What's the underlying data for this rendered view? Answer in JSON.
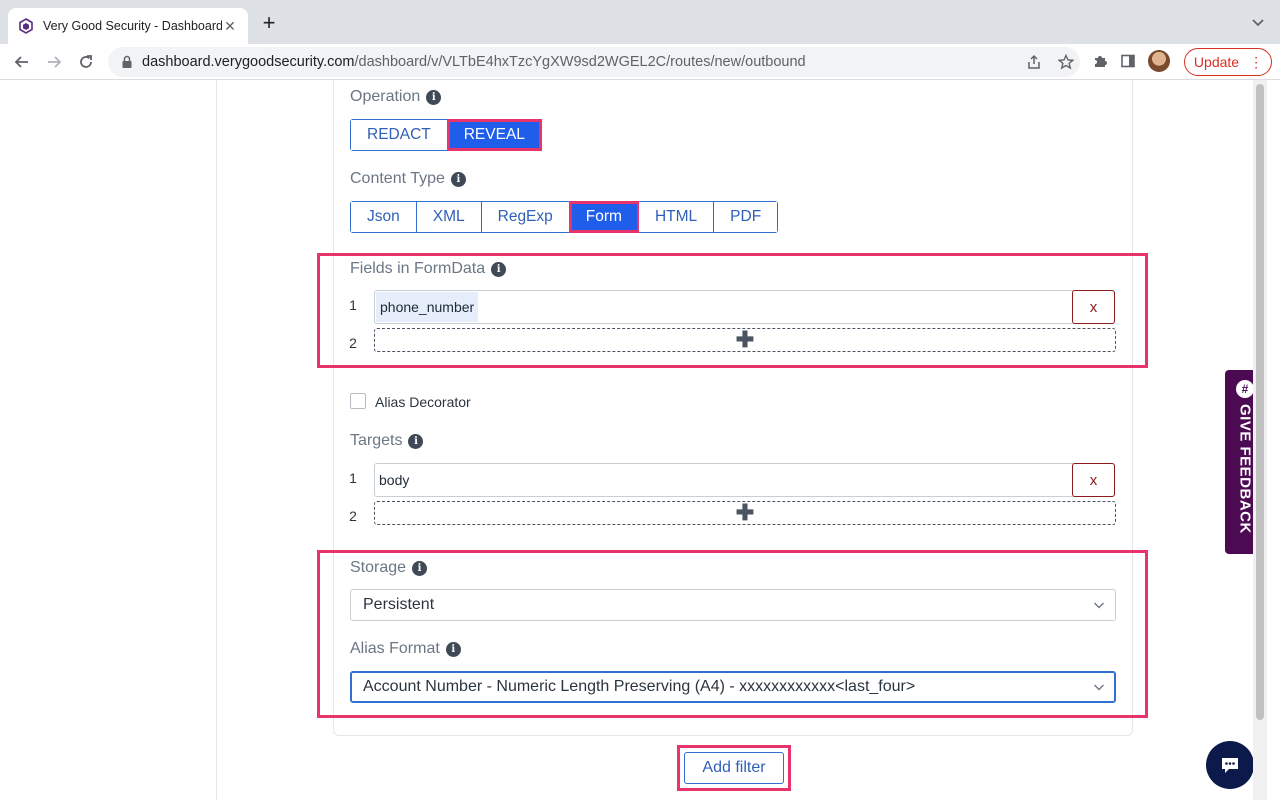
{
  "browser": {
    "tab_title": "Very Good Security - Dashboard",
    "tab_close": "✕",
    "new_tab": "+",
    "url_host": "dashboard.verygoodsecurity.com",
    "url_path": "/dashboard/v/VLTbE4hxTzcYgXW9sd2WGEL2C/routes/new/outbound",
    "update_label": "Update",
    "update_dots": "⋮"
  },
  "form": {
    "operation": {
      "label": "Operation",
      "options": [
        "REDACT",
        "REVEAL"
      ],
      "selected": "REVEAL"
    },
    "content_type": {
      "label": "Content Type",
      "options": [
        "Json",
        "XML",
        "RegExp",
        "Form",
        "HTML",
        "PDF"
      ],
      "selected": "Form"
    },
    "fields_in_formdata": {
      "label": "Fields in FormData",
      "rows": [
        {
          "num": "1",
          "value": "phone_number",
          "remove": "x"
        },
        {
          "num": "2",
          "add": "✚"
        }
      ]
    },
    "alias_decorator": {
      "label": "Alias Decorator",
      "checked": false
    },
    "targets": {
      "label": "Targets",
      "rows": [
        {
          "num": "1",
          "value": "body",
          "remove": "x"
        },
        {
          "num": "2",
          "add": "✚"
        }
      ]
    },
    "storage": {
      "label": "Storage",
      "value": "Persistent"
    },
    "alias_format": {
      "label": "Alias Format",
      "value": "Account Number - Numeric Length Preserving (A4) - xxxxxxxxxxxx<last_four>"
    },
    "add_filter_label": "Add filter"
  },
  "feedback": {
    "label": "GIVE FEEDBACK",
    "icon_char": "#"
  },
  "colors": {
    "accent": "#1f5eea",
    "highlight": "#e8336b",
    "feedback_bg": "#4b0a52",
    "danger": "#8b1a1a"
  },
  "icons": [
    "favicon-icon",
    "back-icon",
    "forward-icon",
    "reload-icon",
    "lock-icon",
    "share-icon",
    "star-icon",
    "extensions-icon",
    "sidepanel-icon",
    "info-icon",
    "chevron-down-icon",
    "chat-icon",
    "plus-icon"
  ]
}
